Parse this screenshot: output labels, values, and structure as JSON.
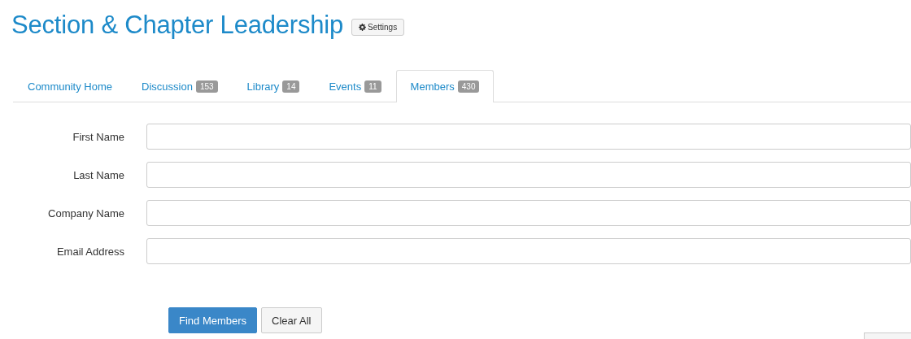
{
  "title": "Section & Chapter Leadership",
  "settings_button": {
    "label": "Settings"
  },
  "tabs": [
    {
      "label": "Community Home",
      "selected": false
    },
    {
      "label": "Discussion",
      "count": "153",
      "selected": false
    },
    {
      "label": "Library",
      "count": "14",
      "selected": false
    },
    {
      "label": "Events",
      "count": "11",
      "selected": false
    },
    {
      "label": "Members",
      "count": "430",
      "selected": true
    }
  ],
  "fields": [
    {
      "label": "First Name"
    },
    {
      "label": "Last Name"
    },
    {
      "label": "Company Name"
    },
    {
      "label": "Email Address"
    }
  ],
  "buttons": [
    {
      "label": "Find Members",
      "kind": "primary"
    },
    {
      "label": "Clear All",
      "kind": "default"
    }
  ]
}
